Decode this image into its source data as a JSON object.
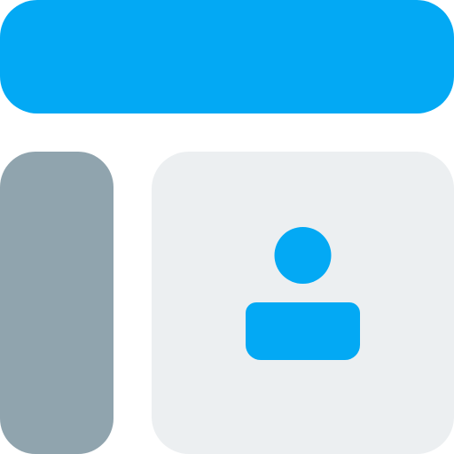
{
  "colors": {
    "header": "#03A9F4",
    "sidebar": "#90A4AE",
    "content": "#ECEFF1",
    "user_icon": "#03A9F4"
  },
  "icons": {
    "user": "user-icon"
  }
}
